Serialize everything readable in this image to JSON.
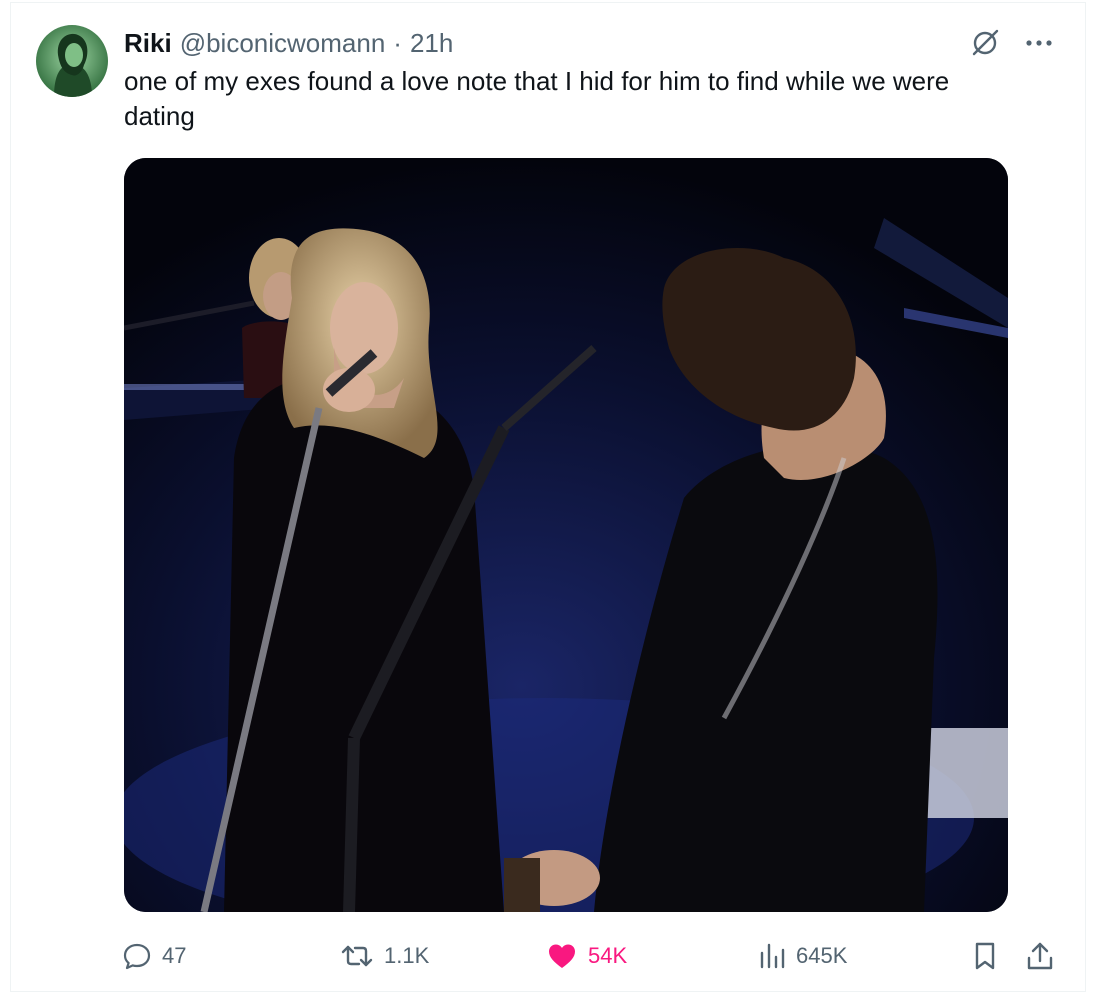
{
  "tweet": {
    "display_name": "Riki",
    "handle": "@biconicwomann",
    "separator": "·",
    "time": "21h",
    "text": "one of my exes found a love note that I hid for him to find while we were dating"
  },
  "media": {
    "description_icon": "video-still"
  },
  "actions": {
    "replies": "47",
    "reposts": "1.1K",
    "likes": "54K",
    "views": "645K"
  },
  "icons": {
    "reply": "reply-icon",
    "repost": "repost-icon",
    "like": "heart-icon",
    "views": "views-icon",
    "bookmark": "bookmark-icon",
    "share": "share-icon",
    "grok": "grok-icon",
    "more": "more-icon"
  },
  "colors": {
    "text_primary": "#0f1419",
    "text_secondary": "#536471",
    "like_active": "#f91880"
  }
}
